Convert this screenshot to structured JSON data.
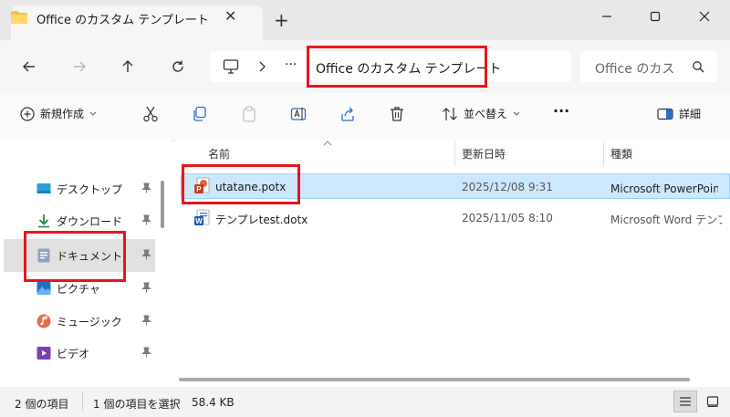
{
  "window": {
    "tab_title": "Office のカスタム テンプレート",
    "tab_close_glyph": "✕",
    "new_tab_glyph": "+"
  },
  "address": {
    "more_glyph": "···",
    "path": "Office のカスタム テンプレート",
    "search_placeholder": "Office のカスタム テンプレートの検索"
  },
  "toolbar": {
    "new_label": "新規作成",
    "sort_label": "並べ替え",
    "more_glyph": "···",
    "details_label": "詳細"
  },
  "sidebar": {
    "items": [
      {
        "label": "デスクトップ",
        "icon": "desktop-icon"
      },
      {
        "label": "ダウンロード",
        "icon": "download-icon"
      },
      {
        "label": "ドキュメント",
        "icon": "documents-icon"
      },
      {
        "label": "ピクチャ",
        "icon": "pictures-icon"
      },
      {
        "label": "ミュージック",
        "icon": "music-icon"
      },
      {
        "label": "ビデオ",
        "icon": "videos-icon"
      }
    ],
    "pin_glyph": "📌"
  },
  "list": {
    "columns": [
      "名前",
      "更新日時",
      "種類"
    ],
    "rows": [
      {
        "name": "utatane.potx",
        "modified": "2025/12/08 9:31",
        "type": "Microsoft PowerPoint テンプレート",
        "icon": "powerpoint-template-icon"
      },
      {
        "name": "テンプレtest.dotx",
        "modified": "2025/11/05 8:10",
        "type": "Microsoft Word テンプレート",
        "icon": "word-template-icon"
      }
    ]
  },
  "status": {
    "count": "2 個の項目",
    "selection": "1 個の項目を選択",
    "size": "58.4 KB"
  },
  "colors": {
    "highlight": "#e8151b",
    "selected_row": "#cce8ff",
    "folder": "#f5c244"
  }
}
